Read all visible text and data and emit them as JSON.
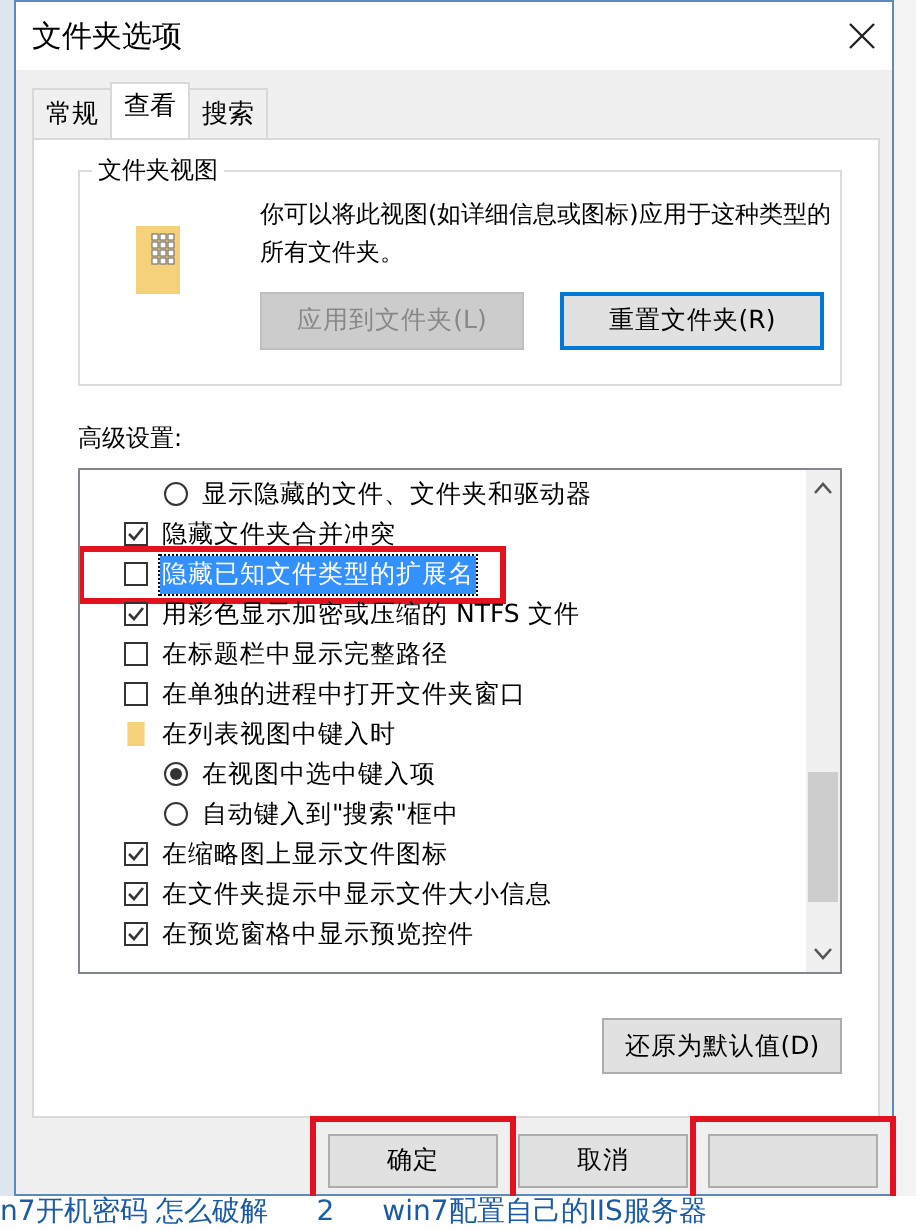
{
  "window": {
    "title": "文件夹选项"
  },
  "tabs": [
    {
      "label": "常规",
      "selected": false
    },
    {
      "label": "查看",
      "selected": true
    },
    {
      "label": "搜索",
      "selected": false
    }
  ],
  "folder_views": {
    "title": "文件夹视图",
    "description": "你可以将此视图(如详细信息或图标)应用于这种类型的所有文件夹。",
    "buttons": [
      {
        "label": "应用到文件夹(L)",
        "disabled": true,
        "focused": false
      },
      {
        "label": "重置文件夹(R)",
        "disabled": false,
        "focused": true
      }
    ]
  },
  "advanced": {
    "label": "高级设置:",
    "items": [
      {
        "kind": "radio",
        "label": "显示隐藏的文件、文件夹和驱动器",
        "checked": false,
        "selected": false,
        "annotated": false
      },
      {
        "kind": "checkbox",
        "label": "隐藏文件夹合并冲突",
        "checked": true,
        "selected": false,
        "annotated": false
      },
      {
        "kind": "checkbox",
        "label": "隐藏已知文件类型的扩展名",
        "checked": false,
        "selected": true,
        "annotated": true
      },
      {
        "kind": "checkbox",
        "label": "用彩色显示加密或压缩的 NTFS 文件",
        "checked": true,
        "selected": false,
        "annotated": false
      },
      {
        "kind": "checkbox",
        "label": "在标题栏中显示完整路径",
        "checked": false,
        "selected": false,
        "annotated": false
      },
      {
        "kind": "checkbox",
        "label": "在单独的进程中打开文件夹窗口",
        "checked": false,
        "selected": false,
        "annotated": false
      },
      {
        "kind": "folder",
        "label": "在列表视图中键入时",
        "selected": false,
        "children": [
          {
            "kind": "radio",
            "label": "在视图中选中键入项",
            "checked": true,
            "selected": false,
            "annotated": false
          },
          {
            "kind": "radio",
            "label": "自动键入到\"搜索\"框中",
            "checked": false,
            "selected": false,
            "annotated": false
          }
        ]
      },
      {
        "kind": "checkbox",
        "label": "在缩略图上显示文件图标",
        "checked": true,
        "selected": false,
        "annotated": false
      },
      {
        "kind": "checkbox",
        "label": "在文件夹提示中显示文件大小信息",
        "checked": true,
        "selected": false,
        "annotated": false
      },
      {
        "kind": "checkbox",
        "label": "在预览窗格中显示预览控件",
        "checked": true,
        "selected": false,
        "annotated": false
      }
    ],
    "restore_button": {
      "label": "还原为默认值(D)"
    }
  },
  "buttons": [
    {
      "label": "确定",
      "annotated": true
    },
    {
      "label": "取消",
      "annotated": false
    },
    {
      "annotated": true
    }
  ],
  "background": {
    "links": [
      "n7开机密码 怎么破解",
      "2",
      "win7配置自己的IIS服务器"
    ]
  }
}
